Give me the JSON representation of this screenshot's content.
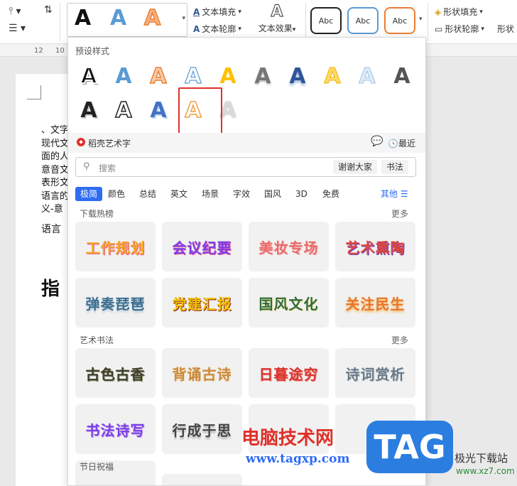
{
  "ribbon": {
    "style_letters": [
      "A",
      "A",
      "A"
    ],
    "text_fill_label": "文本填充",
    "text_outline_label": "文本轮廓",
    "text_effect_label": "文本效果",
    "shape_style_labels": [
      "Abc",
      "Abc",
      "Abc"
    ],
    "shape_fill_label": "形状填充",
    "shape_outline_label": "形状轮廓",
    "shape_other_label": "形状",
    "ruler_nums": [
      "12",
      "10"
    ]
  },
  "doc": {
    "lines": [
      "、文字",
      "现代文",
      "面的人",
      "意音文",
      "表形文",
      "语言的",
      "义-意"
    ],
    "line_lang": "语言",
    "heading": "指"
  },
  "panel": {
    "preset_title": "预设样式",
    "presets": [
      "A",
      "A",
      "A",
      "A",
      "A",
      "A",
      "A",
      "A",
      "A",
      "A",
      "A",
      "A",
      "A",
      "A",
      "A"
    ],
    "daoke_title": "稻壳艺术字",
    "recent_label": "最近",
    "search_placeholder": "搜索",
    "search_tag1": "谢谢大家",
    "search_tag2": "书法",
    "categories": [
      "极简",
      "颜色",
      "总结",
      "英文",
      "场景",
      "字效",
      "国风",
      "3D",
      "免费"
    ],
    "more_label": "其他 ☰",
    "section1_title": "下载热榜",
    "section1_more": "更多",
    "section1_cards": [
      "工作规划",
      "会议纪要",
      "美妆专场",
      "艺术熏陶",
      "弹奏琵琶",
      "党建汇报",
      "国风文化",
      "关注民生"
    ],
    "section2_title": "艺术书法",
    "section2_more": "更多",
    "section2_cards": [
      "古色古香",
      "背诵古诗",
      "日暮途穷",
      "诗词赏析",
      "书法诗写",
      "行成于思",
      "",
      "",
      ""
    ],
    "section3_title": "节日祝福"
  },
  "watermark": {
    "site_name": "电脑技术网",
    "site_url": "www.tagxp.com",
    "logo_text": "TAG",
    "corner_text": "极光下载站",
    "corner_url": "www.xz7.com"
  },
  "colors": {
    "accent": "#2f6cf2",
    "highlight": "#e0302a"
  }
}
